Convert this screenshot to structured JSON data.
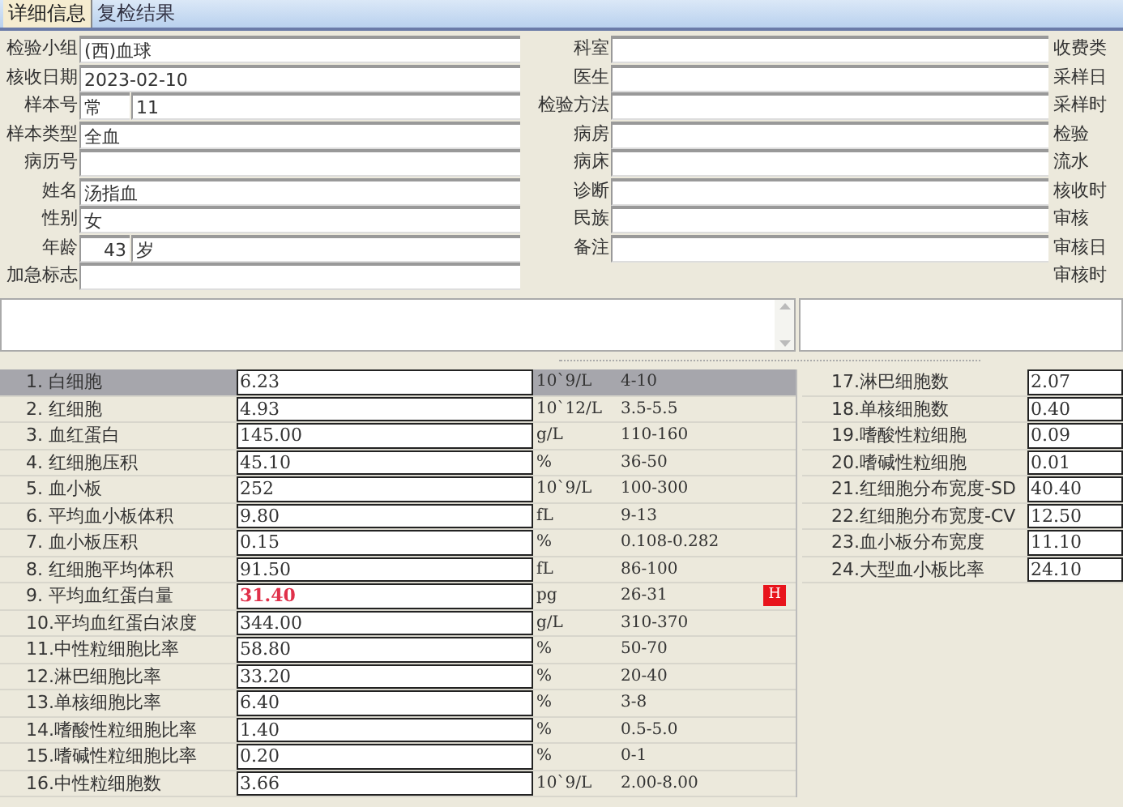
{
  "tabs": [
    {
      "label": "详细信息",
      "selected": true
    },
    {
      "label": "复检结果",
      "selected": false
    }
  ],
  "form_left": [
    {
      "label": "检验小组",
      "value": "(西)血球"
    },
    {
      "label": "核收日期",
      "value": "2023-02-10"
    },
    {
      "label": "样本号",
      "kind": "pair",
      "value": "常",
      "value2": "11"
    },
    {
      "label": "样本类型",
      "value": "全血"
    },
    {
      "label": "病历号"
    },
    {
      "label": "姓名",
      "value": "汤指血"
    },
    {
      "label": "性别",
      "value": "女"
    },
    {
      "label": "年龄",
      "kind": "age",
      "value": "43",
      "value2": "岁"
    },
    {
      "label": "加急标志"
    }
  ],
  "form_middle": [
    {
      "label": "科室"
    },
    {
      "label": "医生"
    },
    {
      "label": "检验方法"
    },
    {
      "label": "病房"
    },
    {
      "label": "病床"
    },
    {
      "label": "诊断"
    },
    {
      "label": "民族"
    },
    {
      "label": "备注"
    }
  ],
  "form_right": [
    {
      "label": "收费类"
    },
    {
      "label": "采样日"
    },
    {
      "label": "采样时"
    },
    {
      "label": "检验"
    },
    {
      "label": "流水"
    },
    {
      "label": "核收时"
    },
    {
      "label": "审核"
    },
    {
      "label": "审核日"
    },
    {
      "label": "审核时"
    }
  ],
  "results": [
    {
      "name": "1. 白细胞",
      "value": "6.23",
      "unit": "10`9/L",
      "range": "4-10",
      "selected": true,
      "abnormal": false
    },
    {
      "name": "2. 红细胞",
      "value": "4.93",
      "unit": "10`12/L",
      "range": "3.5-5.5",
      "selected": false,
      "abnormal": false
    },
    {
      "name": "3. 血红蛋白",
      "value": "145.00",
      "unit": "g/L",
      "range": "110-160",
      "selected": false,
      "abnormal": false
    },
    {
      "name": "4. 红细胞压积",
      "value": "45.10",
      "unit": "%",
      "range": "36-50",
      "selected": false,
      "abnormal": false
    },
    {
      "name": "5. 血小板",
      "value": "252",
      "unit": "10`9/L",
      "range": "100-300",
      "selected": false,
      "abnormal": false
    },
    {
      "name": "6. 平均血小板体积",
      "value": "9.80",
      "unit": "fL",
      "range": "9-13",
      "selected": false,
      "abnormal": false
    },
    {
      "name": "7. 血小板压积",
      "value": "0.15",
      "unit": "%",
      "range": "0.108-0.282",
      "selected": false,
      "abnormal": false
    },
    {
      "name": "8. 红细胞平均体积",
      "value": "91.50",
      "unit": "fL",
      "range": "86-100",
      "selected": false,
      "abnormal": false
    },
    {
      "name": "9. 平均血红蛋白量",
      "value": "31.40",
      "unit": "pg",
      "range": "26-31",
      "selected": false,
      "abnormal": true,
      "flag": "H"
    },
    {
      "name": "10.平均血红蛋白浓度",
      "value": "344.00",
      "unit": "g/L",
      "range": "310-370",
      "selected": false,
      "abnormal": false
    },
    {
      "name": "11.中性粒细胞比率",
      "value": "58.80",
      "unit": "%",
      "range": "50-70",
      "selected": false,
      "abnormal": false
    },
    {
      "name": "12.淋巴细胞比率",
      "value": "33.20",
      "unit": "%",
      "range": "20-40",
      "selected": false,
      "abnormal": false
    },
    {
      "name": "13.单核细胞比率",
      "value": "6.40",
      "unit": "%",
      "range": "3-8",
      "selected": false,
      "abnormal": false
    },
    {
      "name": "14.嗜酸性粒细胞比率",
      "value": "1.40",
      "unit": "%",
      "range": "0.5-5.0",
      "selected": false,
      "abnormal": false
    },
    {
      "name": "15.嗜碱性粒细胞比率",
      "value": "0.20",
      "unit": "%",
      "range": "0-1",
      "selected": false,
      "abnormal": false
    },
    {
      "name": "16.中性粒细胞数",
      "value": "3.66",
      "unit": "10`9/L",
      "range": "2.00-8.00",
      "selected": false,
      "abnormal": false
    }
  ],
  "results_right": [
    {
      "name": "17.淋巴细胞数",
      "value": "2.07"
    },
    {
      "name": "18.单核细胞数",
      "value": "0.40"
    },
    {
      "name": "19.嗜酸性粒细胞",
      "value": "0.09"
    },
    {
      "name": "20.嗜碱性粒细胞",
      "value": "0.01"
    },
    {
      "name": "21.红细胞分布宽度-SD",
      "value": "40.40"
    },
    {
      "name": "22.红细胞分布宽度-CV",
      "value": "12.50"
    },
    {
      "name": "23.血小板分布宽度",
      "value": "11.10"
    },
    {
      "name": "24.大型血小板比率",
      "value": "24.10"
    }
  ]
}
